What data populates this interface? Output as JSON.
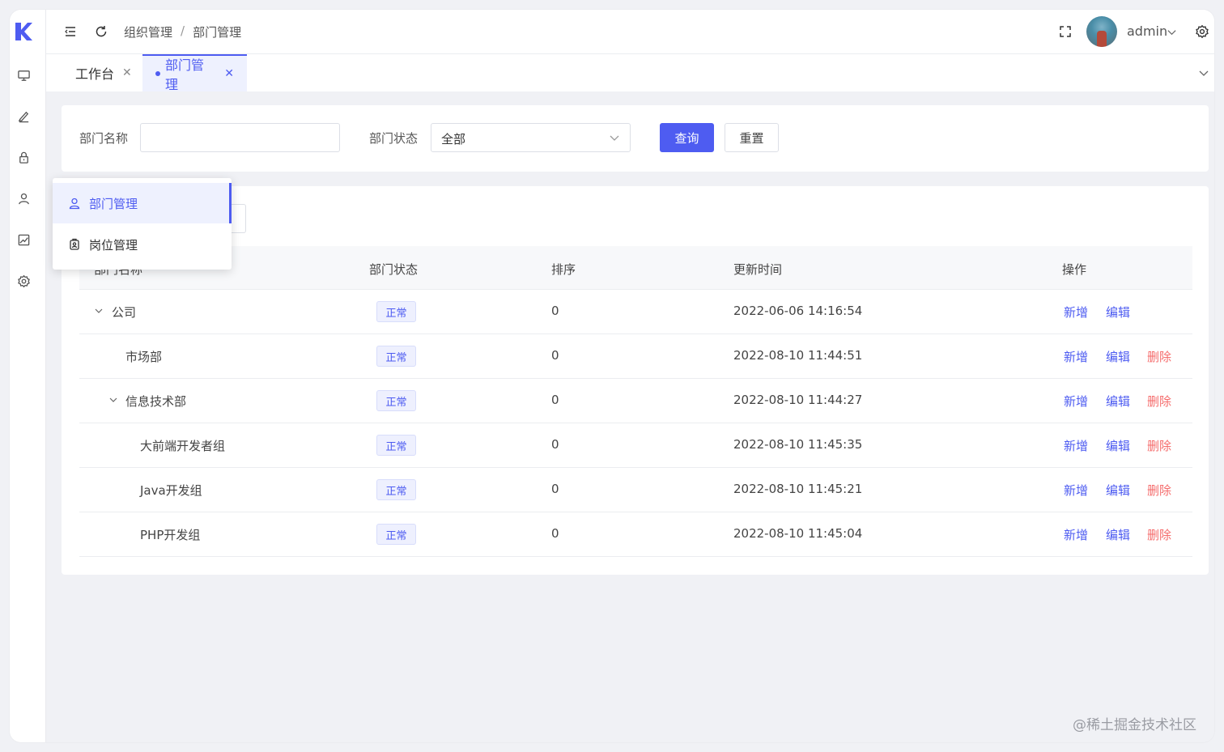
{
  "header": {
    "breadcrumb": [
      "组织管理",
      "部门管理"
    ],
    "breadcrumb_separator": "/",
    "user_name": "admin"
  },
  "tabs": [
    {
      "label": "工作台",
      "active": false
    },
    {
      "label": "部门管理",
      "active": true
    }
  ],
  "search": {
    "name_label": "部门名称",
    "name_value": "",
    "status_label": "部门状态",
    "status_value": "全部",
    "query_button": "查询",
    "reset_button": "重置"
  },
  "popover_menu": [
    {
      "label": "部门管理",
      "icon": "user-icon",
      "active": true
    },
    {
      "label": "岗位管理",
      "icon": "badge-icon",
      "active": false
    }
  ],
  "table": {
    "columns": [
      "部门名称",
      "部门状态",
      "排序",
      "更新时间",
      "操作"
    ],
    "rows": [
      {
        "name": "公司",
        "status": "正常",
        "sort": "0",
        "updated": "2022-06-06 14:16:54",
        "ops": [
          "新增",
          "编辑"
        ]
      },
      {
        "name": "市场部",
        "status": "正常",
        "sort": "0",
        "updated": "2022-08-10 11:44:51",
        "ops": [
          "新增",
          "编辑",
          "删除"
        ]
      },
      {
        "name": "信息技术部",
        "status": "正常",
        "sort": "0",
        "updated": "2022-08-10 11:44:27",
        "ops": [
          "新增",
          "编辑",
          "删除"
        ]
      },
      {
        "name": "大前端开发者组",
        "status": "正常",
        "sort": "0",
        "updated": "2022-08-10 11:45:35",
        "ops": [
          "新增",
          "编辑",
          "删除"
        ]
      },
      {
        "name": "Java开发组",
        "status": "正常",
        "sort": "0",
        "updated": "2022-08-10 11:45:21",
        "ops": [
          "新增",
          "编辑",
          "删除"
        ]
      },
      {
        "name": "PHP开发组",
        "status": "正常",
        "sort": "0",
        "updated": "2022-08-10 11:45:04",
        "ops": [
          "新增",
          "编辑",
          "删除"
        ]
      }
    ]
  },
  "watermark": "@稀土掘金技术社区",
  "colors": {
    "primary": "#4e5cf1",
    "danger": "#f56c6c"
  }
}
